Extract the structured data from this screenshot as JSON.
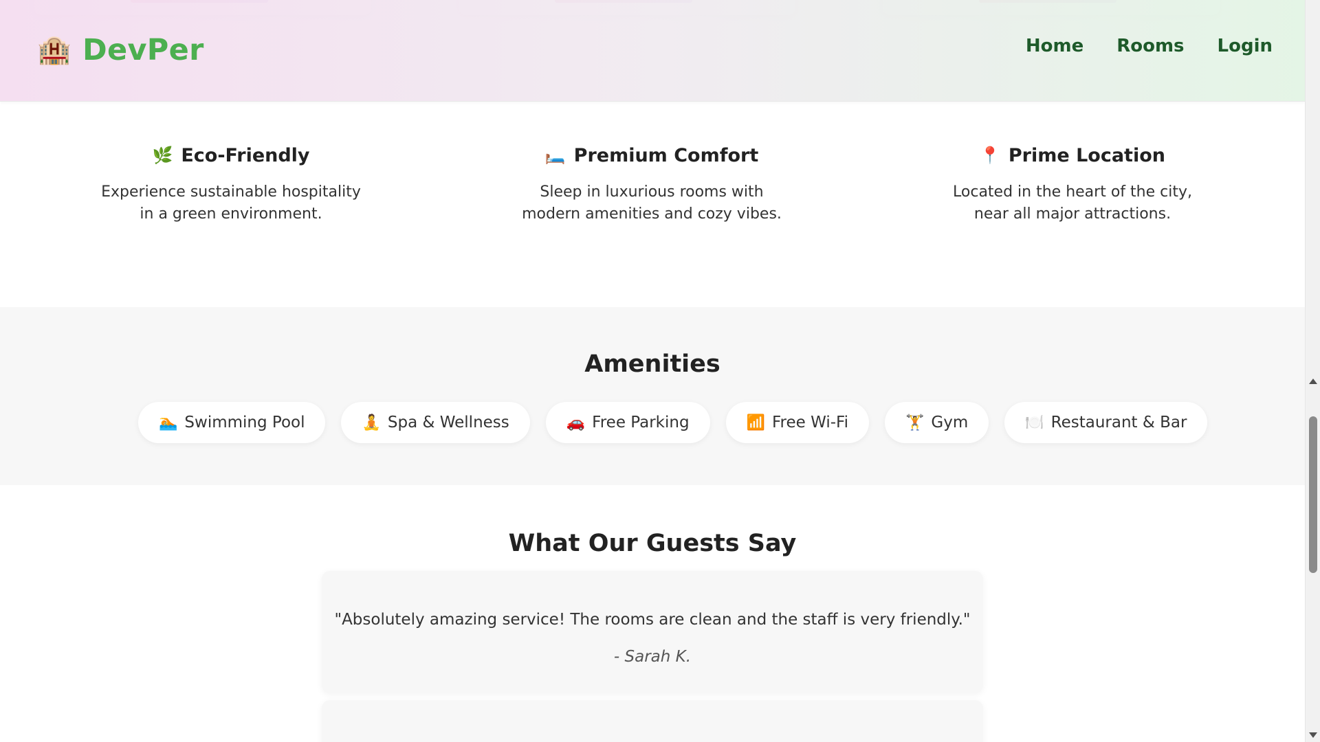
{
  "header": {
    "brand_icon": "🏨",
    "brand_name": "DevPer",
    "nav": [
      "Home",
      "Rooms",
      "Login"
    ]
  },
  "features": [
    {
      "icon": "🌿",
      "title": "Eco-Friendly",
      "desc_line1": "Experience sustainable hospitality",
      "desc_line2": "in a green environment."
    },
    {
      "icon": "🛏️",
      "title": "Premium Comfort",
      "desc_line1": "Sleep in luxurious rooms with",
      "desc_line2": "modern amenities and cozy vibes."
    },
    {
      "icon": "📍",
      "title": "Prime Location",
      "desc_line1": "Located in the heart of the city,",
      "desc_line2": "near all major attractions."
    }
  ],
  "amenities": {
    "title": "Amenities",
    "items": [
      {
        "icon": "🏊",
        "label": "Swimming Pool"
      },
      {
        "icon": "🧘",
        "label": "Spa & Wellness"
      },
      {
        "icon": "🚗",
        "label": "Free Parking"
      },
      {
        "icon": "📶",
        "label": "Free Wi-Fi"
      },
      {
        "icon": "🏋️",
        "label": "Gym"
      },
      {
        "icon": "🍽️",
        "label": "Restaurant & Bar"
      }
    ]
  },
  "testimonials": {
    "title": "What Our Guests Say",
    "items": [
      {
        "quote": "\"Absolutely amazing service! The rooms are clean and the staff is very friendly.\"",
        "author": "- Sarah K."
      }
    ]
  },
  "colors": {
    "brand": "#4caf50",
    "nav": "#1e5a2a",
    "section_bg": "#f7f7f7"
  }
}
